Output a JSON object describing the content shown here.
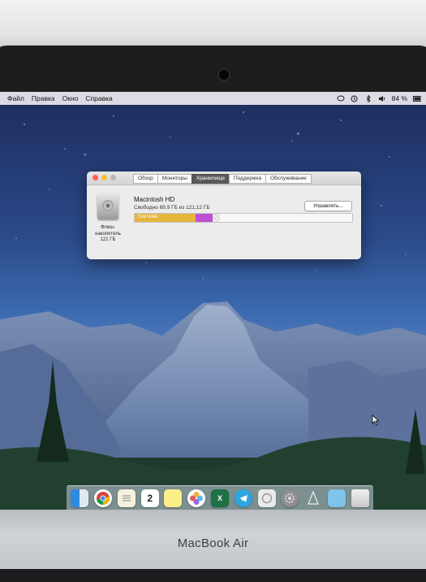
{
  "device": {
    "brand": "MacBook Air"
  },
  "menubar": {
    "items": [
      "Файл",
      "Правка",
      "Окно",
      "Справка"
    ],
    "battery": "84 %"
  },
  "window": {
    "tabs": [
      {
        "label": "Обзор",
        "active": false
      },
      {
        "label": "Мониторы",
        "active": false
      },
      {
        "label": "Хранилище",
        "active": true
      },
      {
        "label": "Поддержка",
        "active": false
      },
      {
        "label": "Обслуживание",
        "active": false
      }
    ],
    "disk": {
      "label_line1": "Флеш-",
      "label_line2": "накопитель",
      "label_line3": "121 ГБ"
    },
    "volume_name": "Macintosh HD",
    "free_text": "Свободно 69,9 ГБ из 121,12 ГБ",
    "manage_button": "Управлять...",
    "storage": {
      "system_label": "Система",
      "system_fraction": 0.28,
      "other_fraction": 0.08,
      "purgeable_fraction": 0.03
    }
  },
  "dock": {
    "icons": [
      "finder-icon",
      "chrome-icon",
      "notes-icon",
      "calendar-icon",
      "stickies-icon",
      "photos-icon",
      "excel-icon",
      "telegram-icon",
      "whatsapp-icon",
      "system-preferences-icon",
      "launchpad-icon",
      "folder-icon",
      "trash-icon"
    ],
    "calendar_day": "2"
  },
  "colors": {
    "accent": "#e7b53a",
    "other": "#c04fd4"
  }
}
